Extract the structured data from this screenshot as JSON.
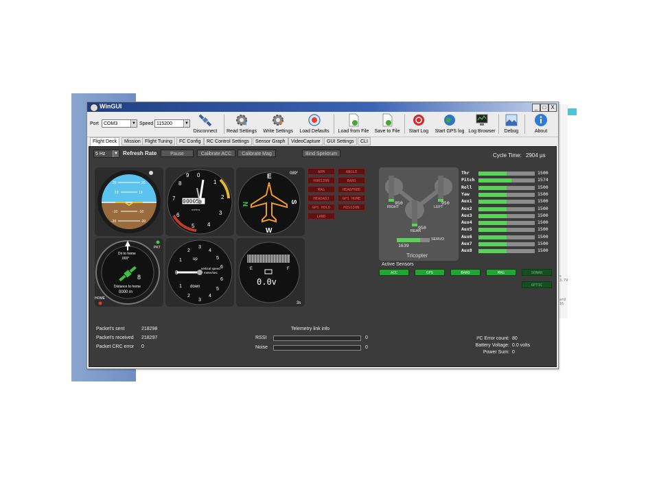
{
  "window": {
    "title": "WinGUI",
    "controls": [
      "_",
      "□",
      "X"
    ]
  },
  "side_notes": {
    "note_a": "s 3.79",
    "note_b": "ard 16"
  },
  "toolbar": {
    "port_label": "Port",
    "port_value": "COM3",
    "speed_label": "Speed",
    "speed_value": "115200",
    "buttons": [
      {
        "label": "Disconnect",
        "icon": "satellite-icon"
      },
      {
        "label": "Read Settings",
        "icon": "gear-read-icon"
      },
      {
        "label": "Write Settings",
        "icon": "gear-write-icon"
      },
      {
        "label": "Load Defaults",
        "icon": "defaults-icon"
      },
      {
        "label": "Load from File",
        "icon": "file-load-icon"
      },
      {
        "label": "Save to File",
        "icon": "file-save-icon"
      },
      {
        "label": "Start Log",
        "icon": "record-icon"
      },
      {
        "label": "Start GPS log",
        "icon": "globe-icon"
      },
      {
        "label": "Log Browser",
        "icon": "monitor-icon"
      },
      {
        "label": "Debug",
        "icon": "debug-icon"
      },
      {
        "label": "About",
        "icon": "info-icon"
      }
    ]
  },
  "tabs": [
    "Flight Deck",
    "Mission",
    "Flight Tuning",
    "FC Config",
    "RC Control Settings",
    "Sensor Graph",
    "VideoCapture",
    "GUI Settings",
    "CLI"
  ],
  "controls": {
    "rate_value": "5 Hz",
    "refresh_label": "Refresh Rate",
    "pause_label": "Pause",
    "calib_acc_label": "Calibrate ACC",
    "calib_mag_label": "Calibrate Mag",
    "bind_label": "Bind Spektrum",
    "cycle_label": "Cycle Time:",
    "cycle_value": "2904 µs"
  },
  "attitude": {
    "ticks": [
      "20",
      "10",
      "10",
      "20",
      "-10",
      "-10",
      "-20",
      "-20"
    ]
  },
  "altimeter": {
    "reading": "00005",
    "unit": "meters",
    "numbers": [
      "0",
      "1",
      "2",
      "3",
      "4",
      "5",
      "6",
      "7",
      "8",
      "9"
    ]
  },
  "heading": {
    "value": "089°",
    "letters": [
      "E",
      "N",
      "S",
      "W"
    ]
  },
  "home": {
    "dir_label": "Dir to home",
    "dir_value": "000°",
    "dist_label": "Distance to home",
    "dist_value": "0000 m",
    "sat_count": "8",
    "pkt": "PKT",
    "home_label": "HOME"
  },
  "vario": {
    "up": "up",
    "down": "down",
    "caption_a": "vertical speed",
    "caption_b": "meter/sec",
    "nums": [
      "0",
      "1",
      "2",
      "3",
      "4",
      "5",
      "6",
      "1",
      "2",
      "3",
      "4",
      "5",
      "6"
    ]
  },
  "battery": {
    "e": "E",
    "f": "F",
    "voltage": "0.0v",
    "timer": "3s"
  },
  "modes": [
    "ARM",
    "ANGLE",
    "HORIZON",
    "BARO",
    "MAG",
    "HEADFREE",
    "HEADADJ",
    "GPS HOME",
    "GPS HOLD",
    "MISSION",
    "LAND"
  ],
  "tricopter": {
    "title": "Tricopter",
    "right_value": "950",
    "right_label": "RIGHT",
    "left_value": "950",
    "left_label": "LEFT",
    "rear_value": "950",
    "rear_label": "REAR",
    "servo_value": "1639",
    "servo_label": "SERVO",
    "servo_fraction": 0.7
  },
  "channels": [
    {
      "name": "Thr",
      "value": "1500",
      "fraction": 0.5
    },
    {
      "name": "Pitch",
      "value": "1574",
      "fraction": 0.58
    },
    {
      "name": "Roll",
      "value": "1500",
      "fraction": 0.5
    },
    {
      "name": "Yaw",
      "value": "1500",
      "fraction": 0.5
    },
    {
      "name": "Aux1",
      "value": "1500",
      "fraction": 0.5
    },
    {
      "name": "Aux2",
      "value": "1500",
      "fraction": 0.5
    },
    {
      "name": "Aux3",
      "value": "1500",
      "fraction": 0.5
    },
    {
      "name": "Aux4",
      "value": "1500",
      "fraction": 0.5
    },
    {
      "name": "Aux5",
      "value": "1500",
      "fraction": 0.5
    },
    {
      "name": "Aux6",
      "value": "1500",
      "fraction": 0.5
    },
    {
      "name": "Aux7",
      "value": "1500",
      "fraction": 0.5
    },
    {
      "name": "Aux8",
      "value": "1500",
      "fraction": 0.5
    }
  ],
  "sensors": {
    "label": "Active Sensors",
    "items": [
      {
        "name": "ACC",
        "active": true
      },
      {
        "name": "GPS",
        "active": true
      },
      {
        "name": "BARO",
        "active": true
      },
      {
        "name": "MAG",
        "active": true
      },
      {
        "name": "SONAR",
        "active": false
      },
      {
        "name": "OPTIC",
        "active": false
      }
    ]
  },
  "stats": {
    "packets_sent_label": "Packet's sent",
    "packets_sent": "218298",
    "packets_received_label": "Packet's received",
    "packets_received": "218297",
    "crc_label": "Packet CRC error",
    "crc": "0"
  },
  "telemetry": {
    "title": "Telemetry link info",
    "rssi_label": "RSSI",
    "rssi_value": "0",
    "noise_label": "Noise",
    "noise_value": "0"
  },
  "status": {
    "i2c_label": "I²C Error count:",
    "i2c_value": "80",
    "battery_label": "Battery Voltage:",
    "battery_value": "0.0 volts",
    "power_label": "Power Sum:",
    "power_value": "0"
  }
}
